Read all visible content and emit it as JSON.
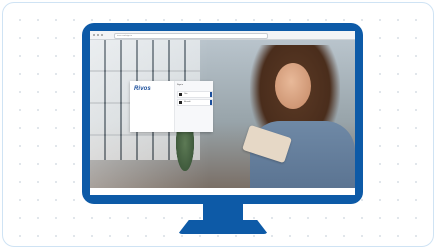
{
  "browser": {
    "url_text": "rivos.com/sign-in"
  },
  "signin_dialog": {
    "logo_text": "Rivos",
    "panel_title": "Sign in",
    "accounts": [
      {
        "label": "Okta"
      },
      {
        "label": "Microsoft"
      }
    ]
  },
  "colors": {
    "brand_blue": "#0d5aa7",
    "logo_blue": "#1b4f9c"
  }
}
